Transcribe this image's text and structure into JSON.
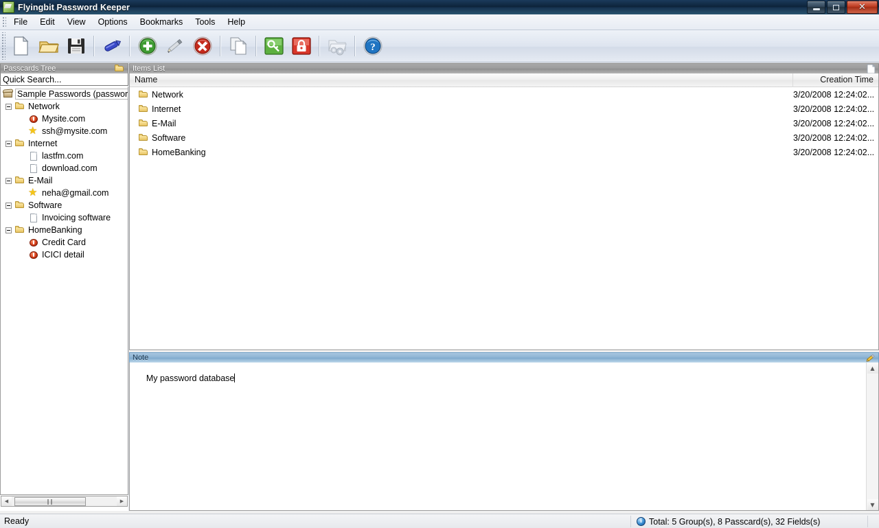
{
  "window": {
    "title": "Flyingbit Password Keeper",
    "app_icon": "app-logo-icon",
    "controls": {
      "minimize": "minimize-button",
      "restore": "restore-button",
      "close": "✕"
    }
  },
  "menu": {
    "items": [
      {
        "label": "File"
      },
      {
        "label": "Edit"
      },
      {
        "label": "View"
      },
      {
        "label": "Options"
      },
      {
        "label": "Bookmarks"
      },
      {
        "label": "Tools"
      },
      {
        "label": "Help"
      }
    ]
  },
  "toolbar": {
    "buttons": [
      {
        "name": "new-database-button",
        "icon": "new-document-icon",
        "tooltip": "New"
      },
      {
        "name": "open-database-button",
        "icon": "open-folder-icon",
        "tooltip": "Open"
      },
      {
        "name": "save-database-button",
        "icon": "save-floppy-icon",
        "tooltip": "Save"
      },
      {
        "name": "sep1",
        "icon": "separator"
      },
      {
        "name": "rename-button",
        "icon": "blue-marker-icon",
        "tooltip": "Rename"
      },
      {
        "name": "sep2",
        "icon": "separator"
      },
      {
        "name": "add-item-button",
        "icon": "green-plus-icon",
        "tooltip": "Add"
      },
      {
        "name": "edit-item-button",
        "icon": "pencil-icon",
        "tooltip": "Edit"
      },
      {
        "name": "delete-item-button",
        "icon": "red-delete-icon",
        "tooltip": "Delete"
      },
      {
        "name": "sep3",
        "icon": "separator"
      },
      {
        "name": "copy-button",
        "icon": "copy-pages-icon",
        "tooltip": "Copy"
      },
      {
        "name": "sep4",
        "icon": "separator"
      },
      {
        "name": "generate-password-button",
        "icon": "green-key-icon",
        "tooltip": "Generate Password"
      },
      {
        "name": "lock-button",
        "icon": "red-lock-icon",
        "tooltip": "Lock"
      },
      {
        "name": "sep5",
        "icon": "separator"
      },
      {
        "name": "settings-button",
        "icon": "folder-gear-icon",
        "tooltip": "Settings",
        "disabled": true
      },
      {
        "name": "sep6",
        "icon": "separator"
      },
      {
        "name": "help-button",
        "icon": "blue-help-icon",
        "tooltip": "Help"
      }
    ]
  },
  "tree_panel": {
    "caption": "Passcards Tree",
    "caption_icon": "folder-icon",
    "quick_search_value": "Quick Search...",
    "nodes": [
      {
        "label": "Sample Passwords (password",
        "icon": "database-root-icon",
        "indent": 0,
        "expander": false,
        "selected": true
      },
      {
        "label": "Network",
        "icon": "folder-icon",
        "indent": 1,
        "expander": true
      },
      {
        "label": "Mysite.com",
        "icon": "passcard-icon",
        "indent": 2,
        "expander": false
      },
      {
        "label": "ssh@mysite.com",
        "icon": "star-icon",
        "indent": 2,
        "expander": false
      },
      {
        "label": "Internet",
        "icon": "folder-icon",
        "indent": 1,
        "expander": true
      },
      {
        "label": "lastfm.com",
        "icon": "document-icon",
        "indent": 2,
        "expander": false
      },
      {
        "label": "download.com",
        "icon": "document-icon",
        "indent": 2,
        "expander": false
      },
      {
        "label": "E-Mail",
        "icon": "folder-icon",
        "indent": 1,
        "expander": true
      },
      {
        "label": "neha@gmail.com",
        "icon": "star-icon",
        "indent": 2,
        "expander": false
      },
      {
        "label": "Software",
        "icon": "folder-icon",
        "indent": 1,
        "expander": true
      },
      {
        "label": "Invoicing software",
        "icon": "document-icon",
        "indent": 2,
        "expander": false
      },
      {
        "label": "HomeBanking",
        "icon": "folder-icon",
        "indent": 1,
        "expander": true
      },
      {
        "label": "Credit Card",
        "icon": "passcard-icon",
        "indent": 2,
        "expander": false
      },
      {
        "label": "ICICI detail",
        "icon": "passcard-icon",
        "indent": 2,
        "expander": false
      }
    ],
    "hscroll": {
      "left_arrow": "◀",
      "right_arrow": "▶",
      "grip": "‖‖"
    }
  },
  "items_panel": {
    "caption": "Items List",
    "caption_icon": "document-icon",
    "columns": [
      "Name",
      "Creation Time"
    ],
    "rows": [
      {
        "icon": "folder-icon",
        "name": "Network",
        "creation_time": "3/20/2008 12:24:02..."
      },
      {
        "icon": "folder-icon",
        "name": "Internet",
        "creation_time": "3/20/2008 12:24:02..."
      },
      {
        "icon": "folder-icon",
        "name": "E-Mail",
        "creation_time": "3/20/2008 12:24:02..."
      },
      {
        "icon": "folder-icon",
        "name": "Software",
        "creation_time": "3/20/2008 12:24:02..."
      },
      {
        "icon": "folder-icon",
        "name": "HomeBanking",
        "creation_time": "3/20/2008 12:24:02..."
      }
    ]
  },
  "note_panel": {
    "caption": "Note",
    "caption_icon": "pencil-icon",
    "text": "My password database",
    "scroll_up": "▲",
    "scroll_down": "▼"
  },
  "status_bar": {
    "left": "Ready",
    "right": "Total: 5 Group(s), 8 Passcard(s), 32 Fields(s)",
    "right_icon": "info-icon"
  },
  "colors": {
    "titlebar": "#0d2339",
    "active_caption": "#8db4d4",
    "inactive_caption": "#9b9b9b",
    "toolbar": "#dde4ef",
    "accent_close": "#bd3a20"
  }
}
